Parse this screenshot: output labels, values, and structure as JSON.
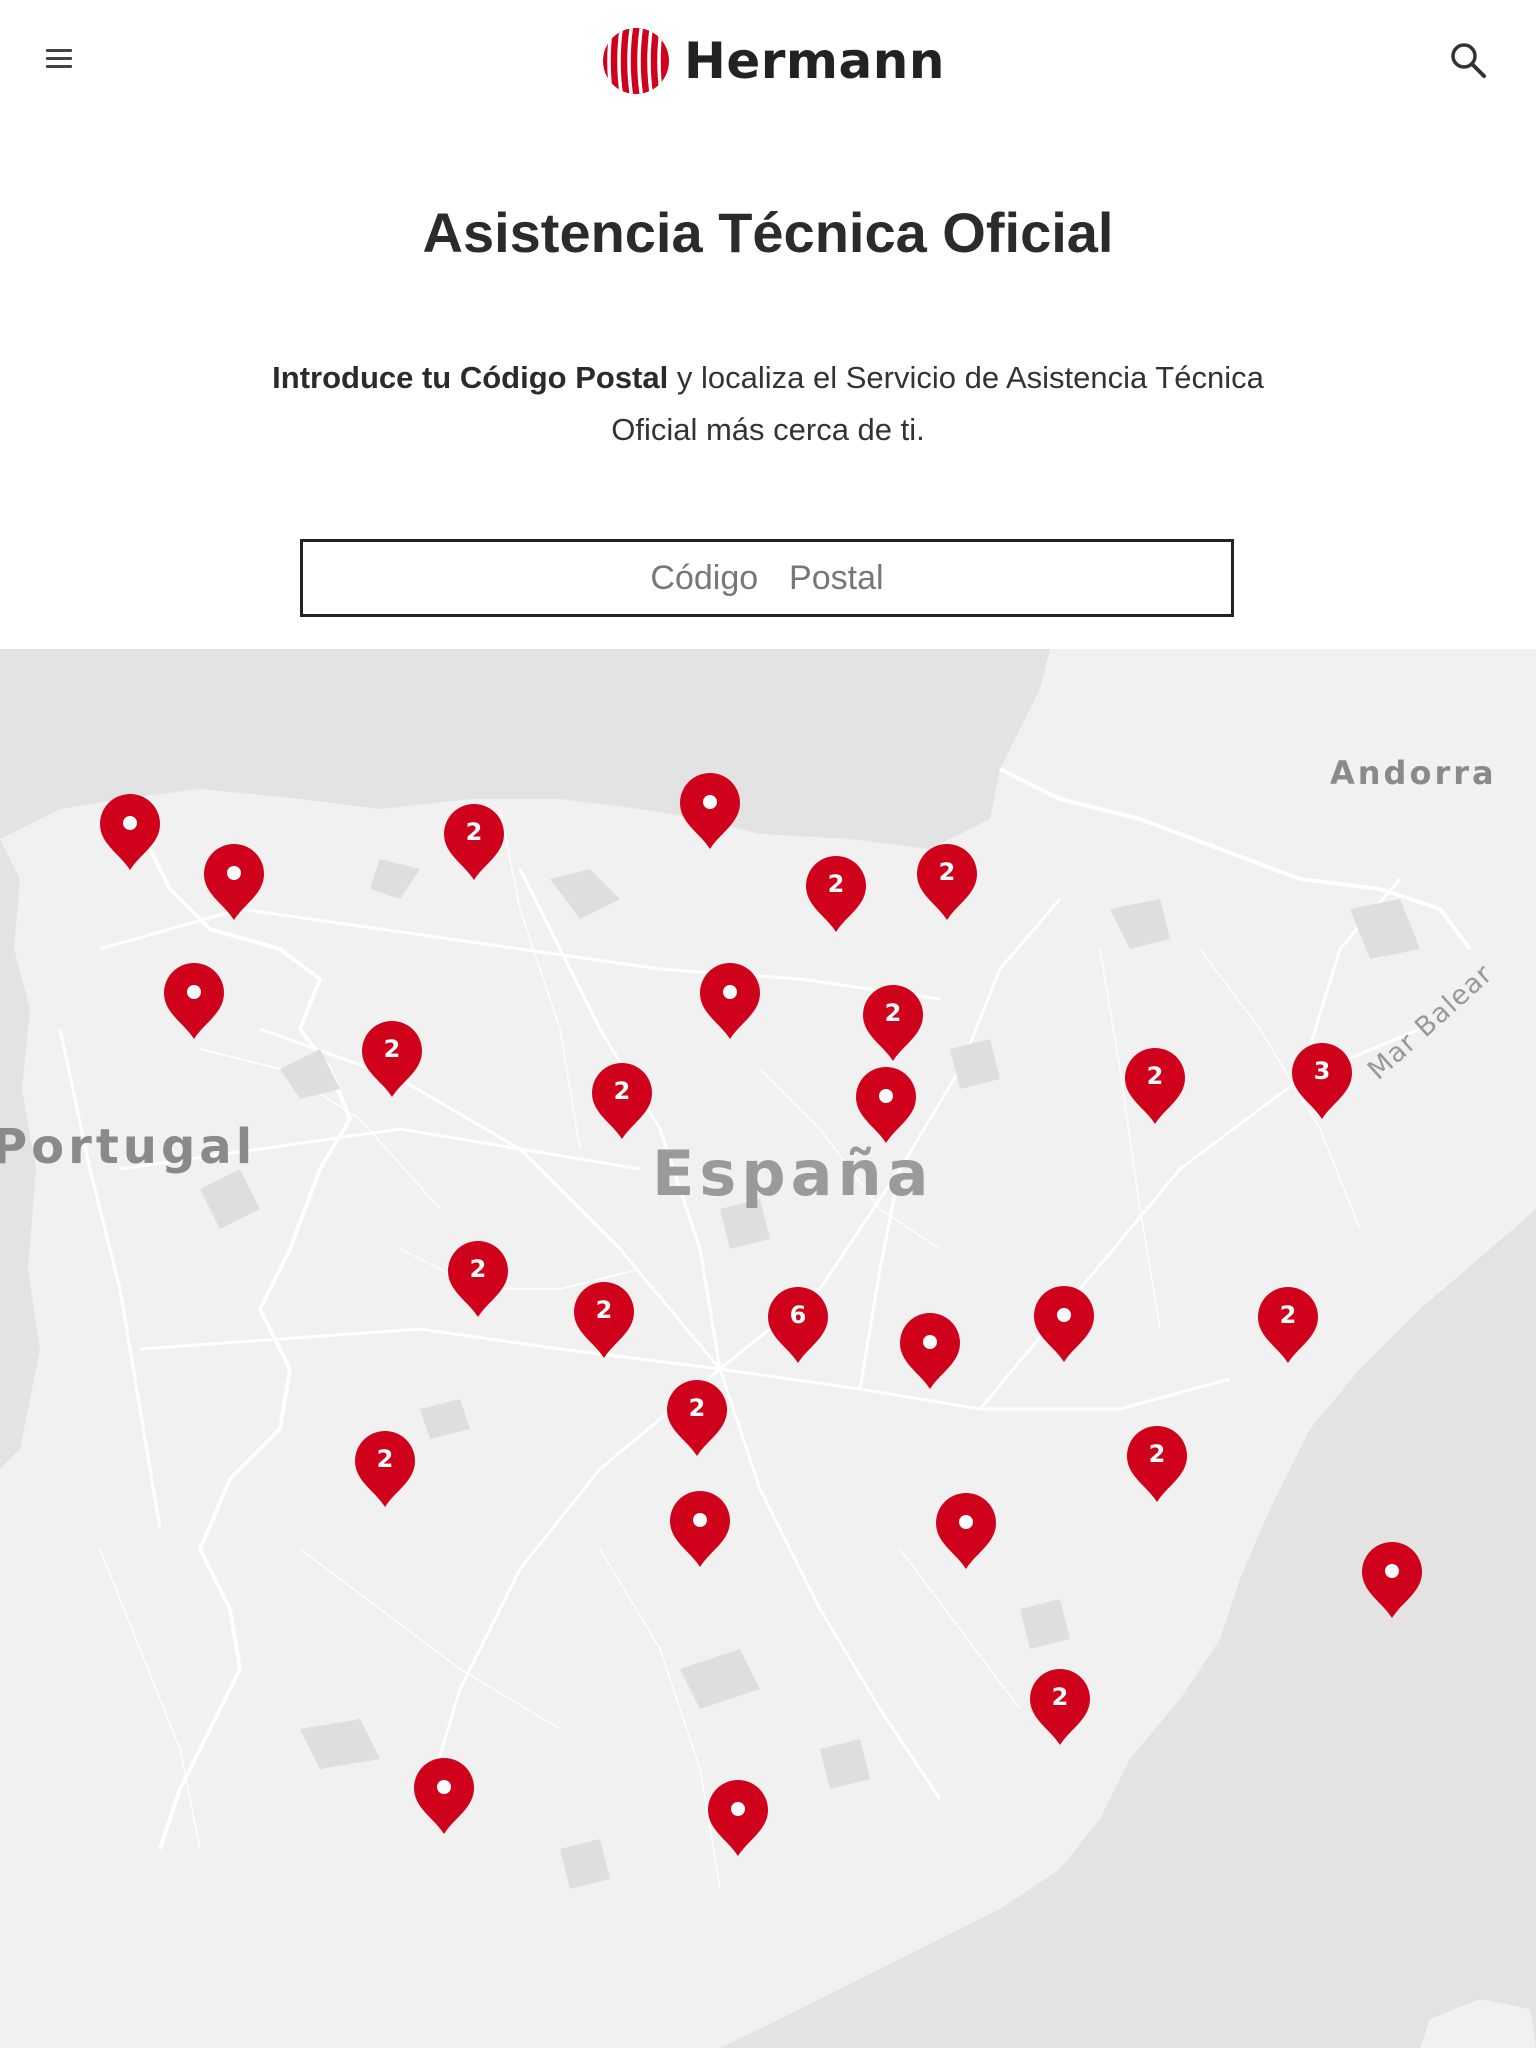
{
  "header": {
    "brand_name": "Hermann",
    "brand_color": "#d0021b",
    "menu_icon": "hamburger-menu-icon",
    "search_icon": "search-icon"
  },
  "main": {
    "title": "Asistencia Técnica Oficial",
    "intro_bold": "Introduce tu Código Postal",
    "intro_rest": " y localiza el Servicio de Asistencia Técnica Oficial más cerca de ti.",
    "postal_input": {
      "placeholder": "Código  Postal",
      "value": ""
    }
  },
  "map": {
    "labels": [
      "Andorra",
      "Portugal",
      "España",
      "Mar Balear"
    ],
    "marker_color": "#d0021b",
    "markers": [
      {
        "type": "single"
      },
      {
        "type": "single"
      },
      {
        "type": "cluster",
        "count": "2"
      },
      {
        "type": "single"
      },
      {
        "type": "cluster",
        "count": "2"
      },
      {
        "type": "cluster",
        "count": "2"
      },
      {
        "type": "single"
      },
      {
        "type": "single"
      },
      {
        "type": "cluster",
        "count": "2"
      },
      {
        "type": "cluster",
        "count": "2"
      },
      {
        "type": "cluster",
        "count": "2"
      },
      {
        "type": "single"
      },
      {
        "type": "cluster",
        "count": "2"
      },
      {
        "type": "cluster",
        "count": "3"
      },
      {
        "type": "cluster",
        "count": "2"
      },
      {
        "type": "cluster",
        "count": "2"
      },
      {
        "type": "cluster",
        "count": "6"
      },
      {
        "type": "single"
      },
      {
        "type": "single"
      },
      {
        "type": "cluster",
        "count": "2"
      },
      {
        "type": "cluster",
        "count": "2"
      },
      {
        "type": "cluster",
        "count": "2"
      },
      {
        "type": "single"
      },
      {
        "type": "single"
      },
      {
        "type": "cluster",
        "count": "2"
      },
      {
        "type": "single"
      },
      {
        "type": "cluster",
        "count": "2"
      },
      {
        "type": "single"
      },
      {
        "type": "single"
      }
    ]
  }
}
